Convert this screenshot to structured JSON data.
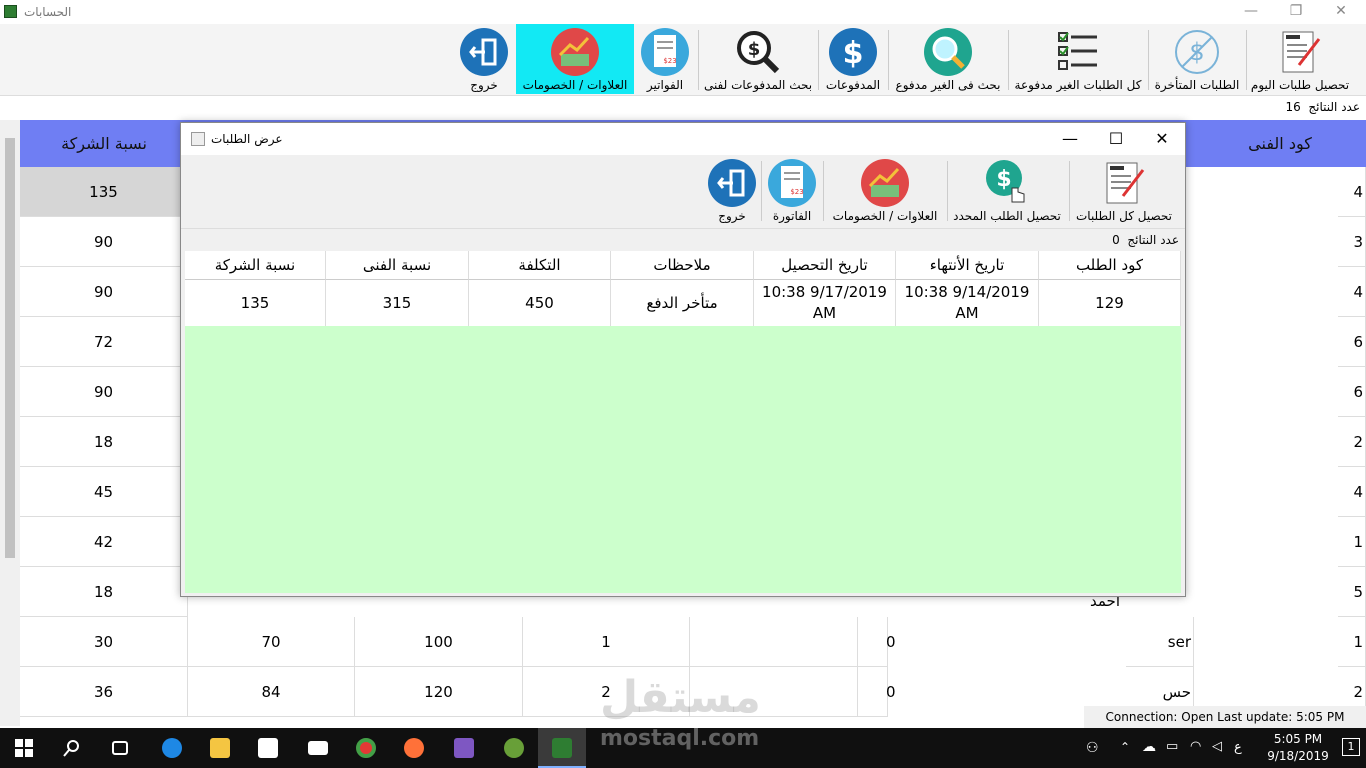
{
  "window": {
    "title": "الحسابات",
    "min": "—",
    "restore": "❐",
    "close": "✕"
  },
  "toolbar": {
    "items": [
      {
        "label": "تحصيل طلبات اليوم",
        "icon": "order-icon"
      },
      {
        "label": "الطلبات المتأخرة",
        "icon": "no-dollar-icon"
      },
      {
        "label": "كل الطلبات الغير مدفوعة",
        "icon": "checklist-icon"
      },
      {
        "label": "بحث فى الغير مدفوع",
        "icon": "search-icon"
      },
      {
        "label": "المدفوعات",
        "icon": "dollar-icon"
      },
      {
        "label": "بحث المدفوعات لفنى",
        "icon": "dollar-search-icon"
      },
      {
        "label": "الفواتير",
        "icon": "receipt-icon"
      },
      {
        "label": "العلاوات / الخصومات",
        "icon": "bonus-icon"
      },
      {
        "label": "خروج",
        "icon": "exit-icon"
      }
    ],
    "active_color": "#12e9f4"
  },
  "results_count": {
    "label": "عدد النتائج",
    "value": "16"
  },
  "background_grid": {
    "col_left_header": "نسبة الشركة",
    "col_right_header": "كود الفنى",
    "left_values": [
      "135",
      "90",
      "90",
      "72",
      "90",
      "18",
      "45",
      "42",
      "18",
      "30",
      "36"
    ],
    "right_values": [
      "4",
      "3",
      "4",
      "6",
      "6",
      "2",
      "4",
      "1",
      "5",
      "1",
      "2"
    ],
    "row9_fragment": "احمد",
    "row10": {
      "c2": "70",
      "c3": "100",
      "c4": "1",
      "c5": "0",
      "c6": "ser"
    },
    "row11": {
      "c2": "84",
      "c3": "120",
      "c4": "2",
      "c5": "0",
      "c6": "حس"
    },
    "header_color": "#6f7ef3"
  },
  "dialog": {
    "title": "عرض الطلبات",
    "toolbar": [
      {
        "label": "تحصيل كل الطلبات",
        "icon": "order-icon"
      },
      {
        "label": "تحصيل الطلب المحدد",
        "icon": "dollar-hand-icon"
      },
      {
        "label": "العلاوات / الخصومات",
        "icon": "bonus-icon"
      },
      {
        "label": "الفاتورة",
        "icon": "receipt-icon"
      },
      {
        "label": "خروج",
        "icon": "exit-icon"
      }
    ],
    "count_label": "عدد النتائج",
    "count_value": "0",
    "columns": [
      "كود الطلب",
      "تاريخ الأنتهاء",
      "تاريخ التحصيل",
      "ملاحظات",
      "التكلفة",
      "نسبة الفنى",
      "نسبة الشركة"
    ],
    "rows": [
      [
        "129",
        "10:38 9/14/2019 AM",
        "10:38 9/17/2019 AM",
        "متأخر الدفع",
        "450",
        "315",
        "135"
      ]
    ],
    "grid_bg": "#ccffcc"
  },
  "status": {
    "text": "Connection: Open Last update: 5:05 PM"
  },
  "taskbar": {
    "time": "5:05 PM",
    "date": "9/18/2019",
    "lang": "ع",
    "notif": "1"
  },
  "watermark": {
    "arabic": "مستقل",
    "latin": "mostaql.com"
  }
}
